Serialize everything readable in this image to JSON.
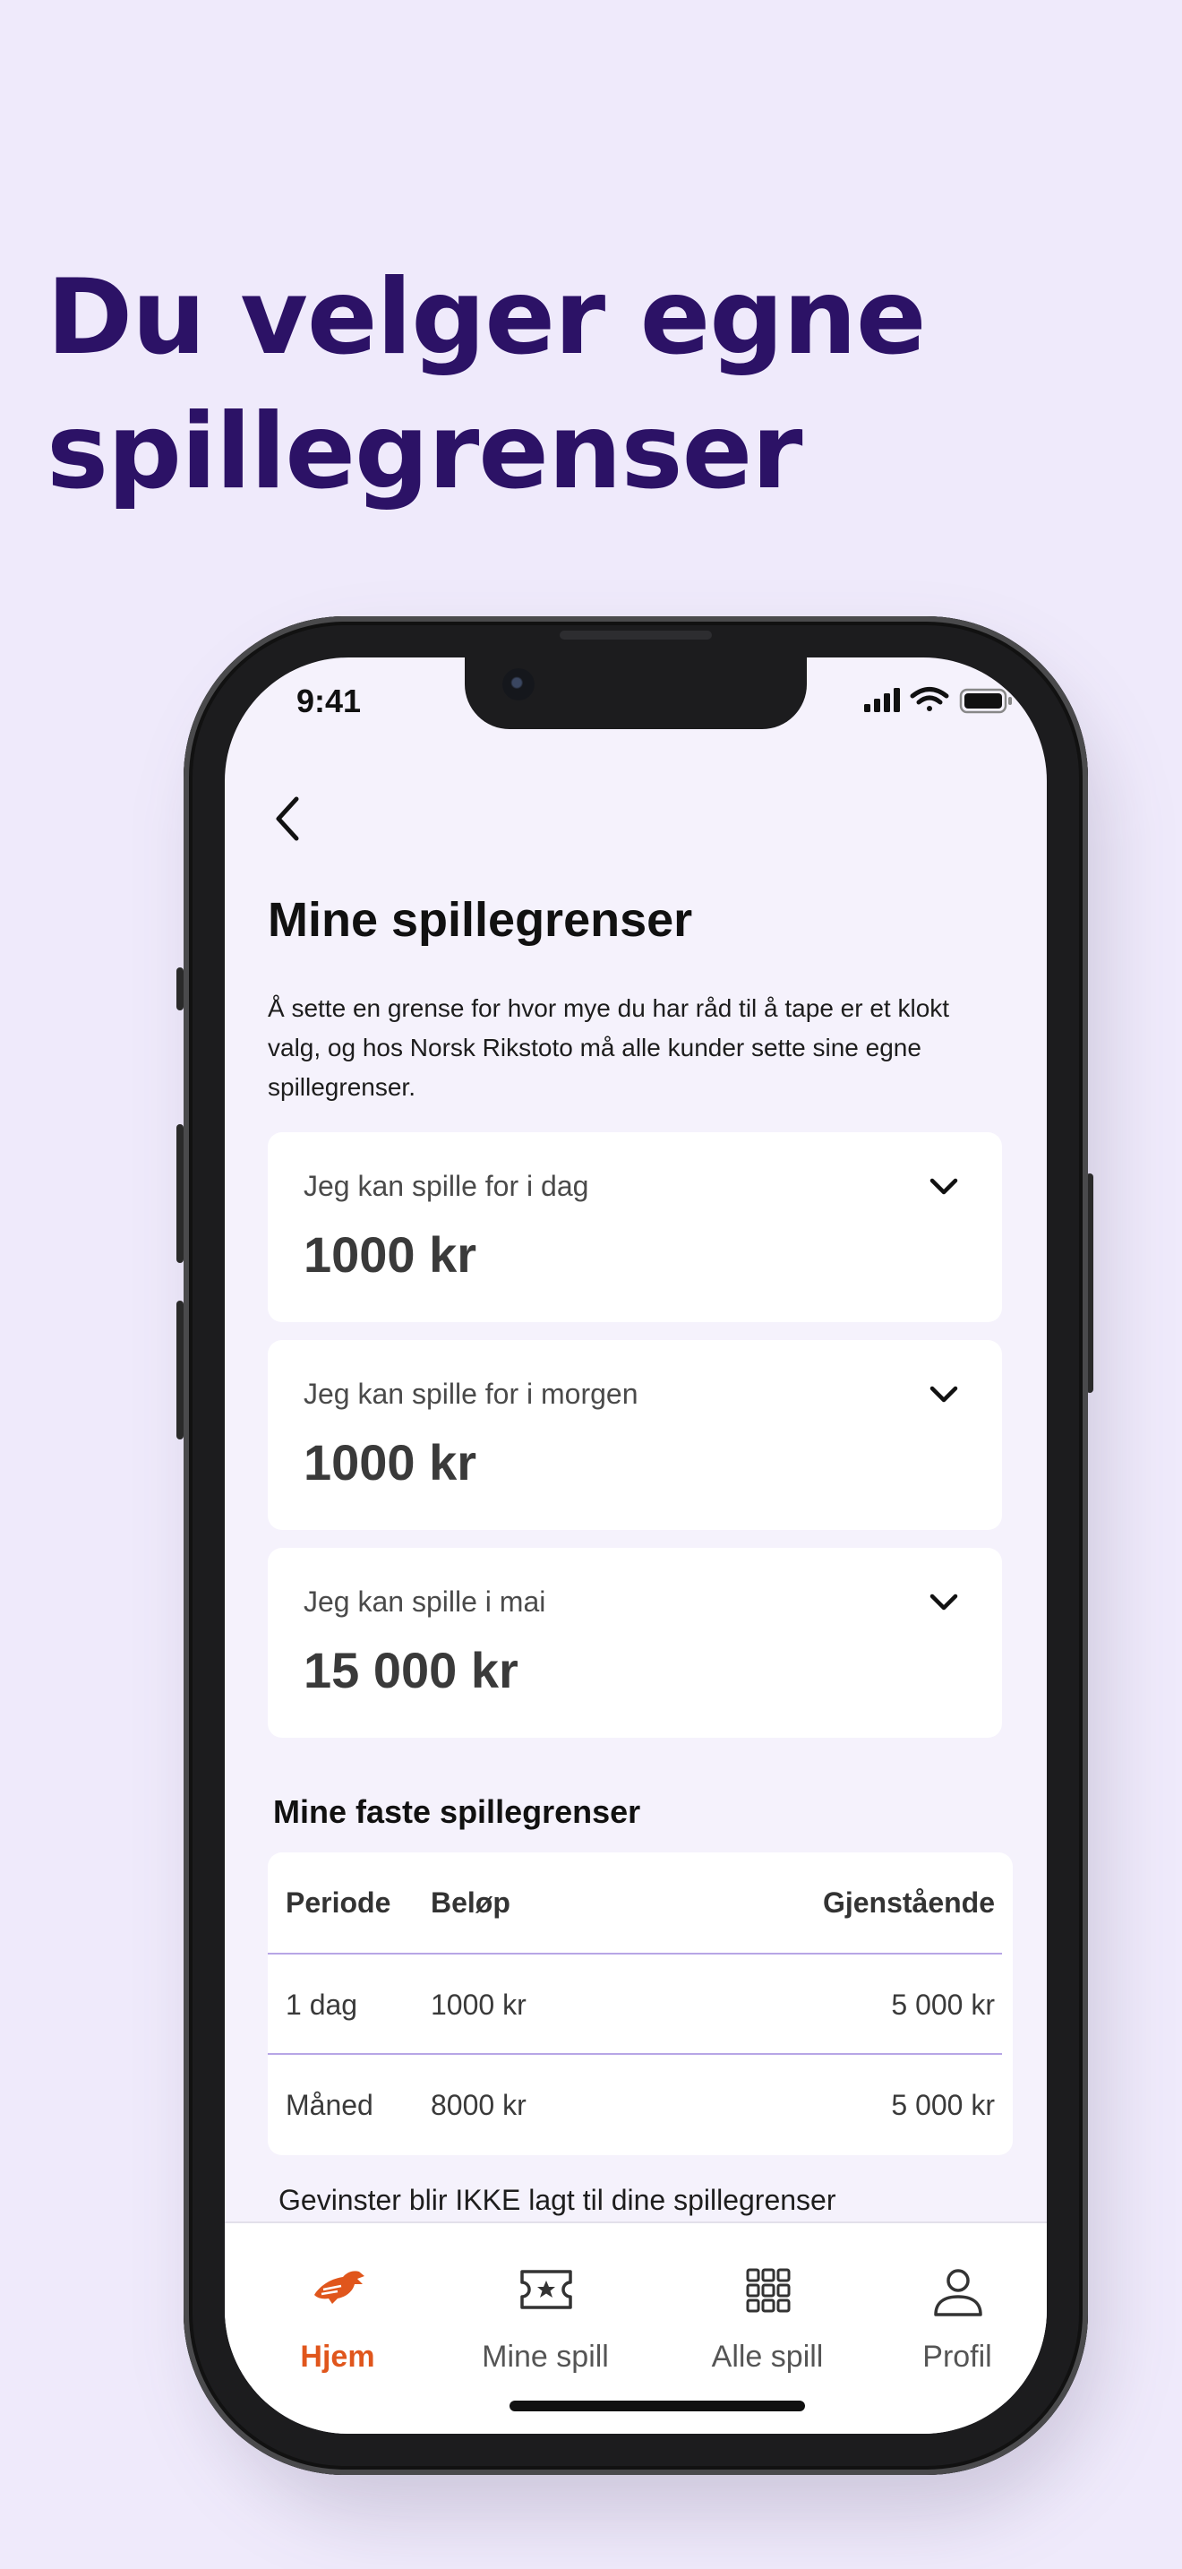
{
  "headline": {
    "line1": "Du velger egne",
    "line2": "spillegrenser"
  },
  "status_bar": {
    "time": "9:41"
  },
  "page": {
    "title": "Mine spillegrenser",
    "intro": "Å sette en grense for hvor mye du har råd til å tape er et klokt valg, og hos Norsk Rikstoto må alle kunder sette sine egne spillegrenser."
  },
  "limits": [
    {
      "label": "Jeg kan spille for i dag",
      "value": "1000 kr"
    },
    {
      "label": "Jeg kan spille for i morgen",
      "value": "1000 kr"
    },
    {
      "label": "Jeg kan spille i mai",
      "value": "15 000 kr"
    }
  ],
  "fixed_limits": {
    "title": "Mine faste spillegrenser",
    "columns": [
      "Periode",
      "Beløp",
      "Gjenstående"
    ],
    "rows": [
      [
        "1 dag",
        "1000 kr",
        "5 000 kr"
      ],
      [
        "Måned",
        "8000 kr",
        "5 000 kr"
      ]
    ]
  },
  "note": "Gevinster blir IKKE lagt til dine spillegrenser",
  "tabbar": {
    "items": [
      {
        "label": "Hjem",
        "icon": "horse-icon",
        "active": true
      },
      {
        "label": "Mine spill",
        "icon": "ticket-icon"
      },
      {
        "label": "Alle spill",
        "icon": "grid-icon"
      },
      {
        "label": "Profil",
        "icon": "person-icon"
      }
    ]
  },
  "colors": {
    "accent": "#e0561c",
    "headline": "#2c1266",
    "background": "#efeafb",
    "divider": "#b7a6e6"
  }
}
